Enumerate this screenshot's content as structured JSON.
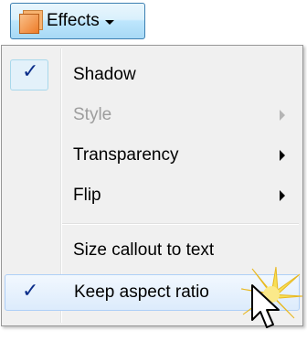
{
  "toolbar": {
    "effects_label": "Effects",
    "effects_icon": "shape-effects-icon",
    "dropdown_icon": "chevron-down-icon"
  },
  "menu": {
    "items": [
      {
        "label": "Shadow",
        "checked": true,
        "enabled": true,
        "has_submenu": false
      },
      {
        "label": "Style",
        "checked": false,
        "enabled": false,
        "has_submenu": true
      },
      {
        "label": "Transparency",
        "checked": false,
        "enabled": true,
        "has_submenu": true
      },
      {
        "label": "Flip",
        "checked": false,
        "enabled": true,
        "has_submenu": true
      },
      {
        "label": "Size callout to text",
        "checked": false,
        "enabled": true,
        "has_submenu": false
      },
      {
        "label": "Keep aspect ratio",
        "checked": true,
        "enabled": true,
        "has_submenu": false,
        "hovered": true
      }
    ]
  },
  "colors": {
    "check_mark": "#0c2e8a",
    "disabled_text": "#9d9d9d",
    "burst": "#f7df55"
  },
  "cursor": "mouse-pointer-icon"
}
